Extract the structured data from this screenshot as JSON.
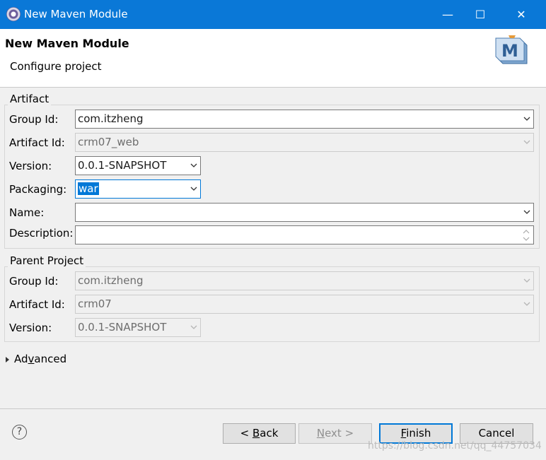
{
  "window": {
    "title": "New Maven Module",
    "minimize_glyph": "—",
    "maximize_glyph": "☐",
    "close_glyph": "✕"
  },
  "header": {
    "title": "New Maven Module",
    "subtitle": "Configure project",
    "logo_letter": "M"
  },
  "artifact": {
    "group_label": "Artifact",
    "group_id_label": "Group Id:",
    "group_id_value": "com.itzheng",
    "artifact_id_label": "Artifact Id:",
    "artifact_id_value": "crm07_web",
    "version_label": "Version:",
    "version_value": "0.0.1-SNAPSHOT",
    "packaging_label": "Packaging:",
    "packaging_value": "war",
    "name_label": "Name:",
    "name_value": "",
    "description_label": "Description:",
    "description_value": ""
  },
  "parent": {
    "group_label": "Parent Project",
    "group_id_label": "Group Id:",
    "group_id_value": "com.itzheng",
    "artifact_id_label": "Artifact Id:",
    "artifact_id_value": "crm07",
    "version_label": "Version:",
    "version_value": "0.0.1-SNAPSHOT"
  },
  "advanced": {
    "label_underlined": "v",
    "label_pre": "Ad",
    "label_post": "anced"
  },
  "buttons": {
    "help_glyph": "?",
    "back_pre": "< ",
    "back_key": "B",
    "back_post": "ack",
    "next_key": "N",
    "next_post": "ext >",
    "finish_key": "F",
    "finish_post": "inish",
    "cancel": "Cancel"
  },
  "watermark": "https://blog.csdn.net/qq_44757034",
  "colors": {
    "titlebar": "#0a78d7",
    "focus": "#0078d7",
    "selection": "#0078d7"
  }
}
